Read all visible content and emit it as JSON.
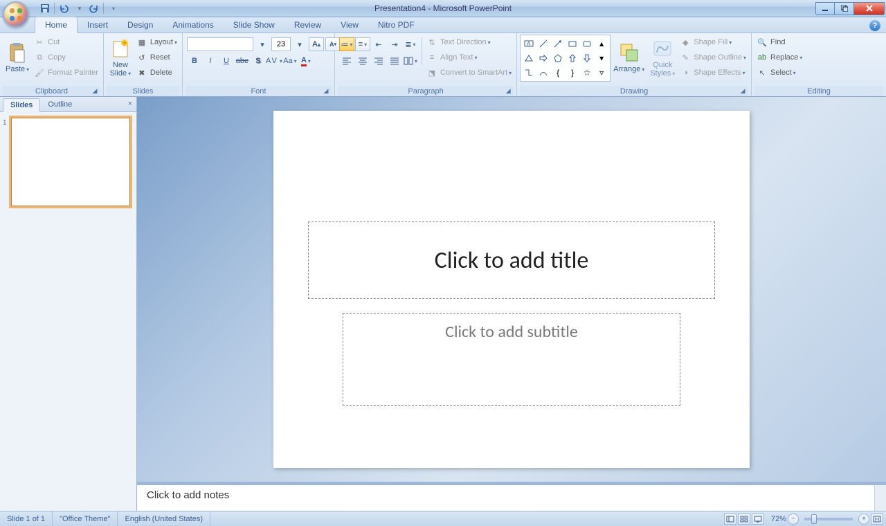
{
  "title": "Presentation4 - Microsoft PowerPoint",
  "tabs": [
    "Home",
    "Insert",
    "Design",
    "Animations",
    "Slide Show",
    "Review",
    "View",
    "Nitro PDF"
  ],
  "active_tab": "Home",
  "clipboard": {
    "label": "Clipboard",
    "paste": "Paste",
    "cut": "Cut",
    "copy": "Copy",
    "painter": "Format Painter"
  },
  "slides_group": {
    "label": "Slides",
    "new": "New\nSlide",
    "layout": "Layout",
    "reset": "Reset",
    "delete": "Delete"
  },
  "font_group": {
    "label": "Font",
    "name": "",
    "size": "23"
  },
  "paragraph_group": {
    "label": "Paragraph",
    "textdir": "Text Direction",
    "align": "Align Text",
    "smartart": "Convert to SmartArt"
  },
  "drawing_group": {
    "label": "Drawing",
    "arrange": "Arrange",
    "quick": "Quick\nStyles",
    "fill": "Shape Fill",
    "outline": "Shape Outline",
    "effects": "Shape Effects"
  },
  "editing_group": {
    "label": "Editing",
    "find": "Find",
    "replace": "Replace",
    "select": "Select"
  },
  "pane_tabs": {
    "slides": "Slides",
    "outline": "Outline"
  },
  "thumb_num": "1",
  "placeholders": {
    "title": "Click to add title",
    "subtitle": "Click to add subtitle"
  },
  "notes_placeholder": "Click to add notes",
  "status": {
    "slide": "Slide 1 of 1",
    "theme": "\"Office Theme\"",
    "lang": "English (United States)",
    "zoom": "72%"
  }
}
